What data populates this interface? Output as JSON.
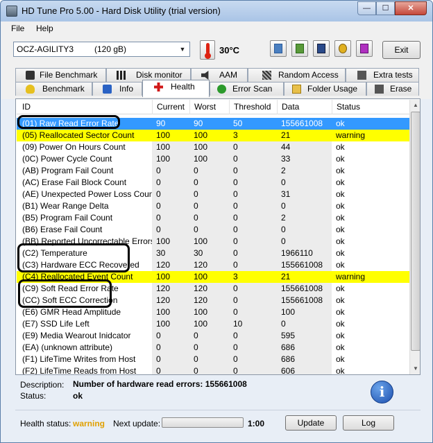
{
  "window": {
    "title": "HD Tune Pro 5.00 - Hard Disk Utility (trial version)"
  },
  "menu": {
    "file": "File",
    "help": "Help"
  },
  "toolbar": {
    "drive_name": "OCZ-AGILITY3",
    "drive_size": "(120 gB)",
    "temperature": "30°C",
    "exit_label": "Exit"
  },
  "tabs_top": [
    "File Benchmark",
    "Disk monitor",
    "AAM",
    "Random Access",
    "Extra tests"
  ],
  "tabs_bottom": [
    "Benchmark",
    "Info",
    "Health",
    "Error Scan",
    "Folder Usage",
    "Erase"
  ],
  "active_tab": "Health",
  "table": {
    "headers": [
      "ID",
      "Current",
      "Worst",
      "Threshold",
      "Data",
      "Status"
    ],
    "rows": [
      {
        "id": "(01) Raw Read Error Rate",
        "current": "90",
        "worst": "90",
        "threshold": "50",
        "data": "155661008",
        "status": "ok",
        "state": "selected"
      },
      {
        "id": "(05) Reallocated Sector Count",
        "current": "100",
        "worst": "100",
        "threshold": "3",
        "data": "21",
        "status": "warning",
        "state": "warning"
      },
      {
        "id": "(09) Power On Hours Count",
        "current": "100",
        "worst": "100",
        "threshold": "0",
        "data": "44",
        "status": "ok",
        "state": ""
      },
      {
        "id": "(0C) Power Cycle Count",
        "current": "100",
        "worst": "100",
        "threshold": "0",
        "data": "33",
        "status": "ok",
        "state": ""
      },
      {
        "id": "(AB) Program Fail Count",
        "current": "0",
        "worst": "0",
        "threshold": "0",
        "data": "2",
        "status": "ok",
        "state": ""
      },
      {
        "id": "(AC) Erase Fail Block Count",
        "current": "0",
        "worst": "0",
        "threshold": "0",
        "data": "0",
        "status": "ok",
        "state": ""
      },
      {
        "id": "(AE) Unexpected Power Loss Count",
        "current": "0",
        "worst": "0",
        "threshold": "0",
        "data": "31",
        "status": "ok",
        "state": ""
      },
      {
        "id": "(B1) Wear Range Delta",
        "current": "0",
        "worst": "0",
        "threshold": "0",
        "data": "0",
        "status": "ok",
        "state": ""
      },
      {
        "id": "(B5) Program Fail Count",
        "current": "0",
        "worst": "0",
        "threshold": "0",
        "data": "2",
        "status": "ok",
        "state": ""
      },
      {
        "id": "(B6) Erase Fail Count",
        "current": "0",
        "worst": "0",
        "threshold": "0",
        "data": "0",
        "status": "ok",
        "state": ""
      },
      {
        "id": "(BB) Reported Uncorrectable Errors",
        "current": "100",
        "worst": "100",
        "threshold": "0",
        "data": "0",
        "status": "ok",
        "state": ""
      },
      {
        "id": "(C2) Temperature",
        "current": "30",
        "worst": "30",
        "threshold": "0",
        "data": "1966110",
        "status": "ok",
        "state": ""
      },
      {
        "id": "(C3) Hardware ECC Recovered",
        "current": "120",
        "worst": "120",
        "threshold": "0",
        "data": "155661008",
        "status": "ok",
        "state": ""
      },
      {
        "id": "(C4) Reallocated Event Count",
        "current": "100",
        "worst": "100",
        "threshold": "3",
        "data": "21",
        "status": "warning",
        "state": "warning"
      },
      {
        "id": "(C9) Soft Read Error Rate",
        "current": "120",
        "worst": "120",
        "threshold": "0",
        "data": "155661008",
        "status": "ok",
        "state": ""
      },
      {
        "id": "(CC) Soft ECC Correction",
        "current": "120",
        "worst": "120",
        "threshold": "0",
        "data": "155661008",
        "status": "ok",
        "state": ""
      },
      {
        "id": "(E6) GMR Head Amplitude",
        "current": "100",
        "worst": "100",
        "threshold": "0",
        "data": "100",
        "status": "ok",
        "state": ""
      },
      {
        "id": "(E7) SSD Life Left",
        "current": "100",
        "worst": "100",
        "threshold": "10",
        "data": "0",
        "status": "ok",
        "state": ""
      },
      {
        "id": "(E9) Media Wearout Inidcator",
        "current": "0",
        "worst": "0",
        "threshold": "0",
        "data": "595",
        "status": "ok",
        "state": ""
      },
      {
        "id": "(EA) (unknown attribute)",
        "current": "0",
        "worst": "0",
        "threshold": "0",
        "data": "686",
        "status": "ok",
        "state": ""
      },
      {
        "id": "(F1) LifeTime Writes from Host",
        "current": "0",
        "worst": "0",
        "threshold": "0",
        "data": "686",
        "status": "ok",
        "state": ""
      },
      {
        "id": "(F2) LifeTime Reads from Host",
        "current": "0",
        "worst": "0",
        "threshold": "0",
        "data": "606",
        "status": "ok",
        "state": ""
      }
    ]
  },
  "details": {
    "description_label": "Description:",
    "description_value": "Number of hardware read errors: 155661008",
    "status_label": "Status:",
    "status_value": "ok"
  },
  "footer": {
    "health_label": "Health status:",
    "health_value": "warning",
    "next_update_label": "Next update:",
    "next_update_value": "1:00",
    "update_label": "Update",
    "log_label": "Log"
  },
  "colors": {
    "selected_row": "#3399ff",
    "warning_row": "#ffff00",
    "health_warning_text": "#e0a000"
  }
}
